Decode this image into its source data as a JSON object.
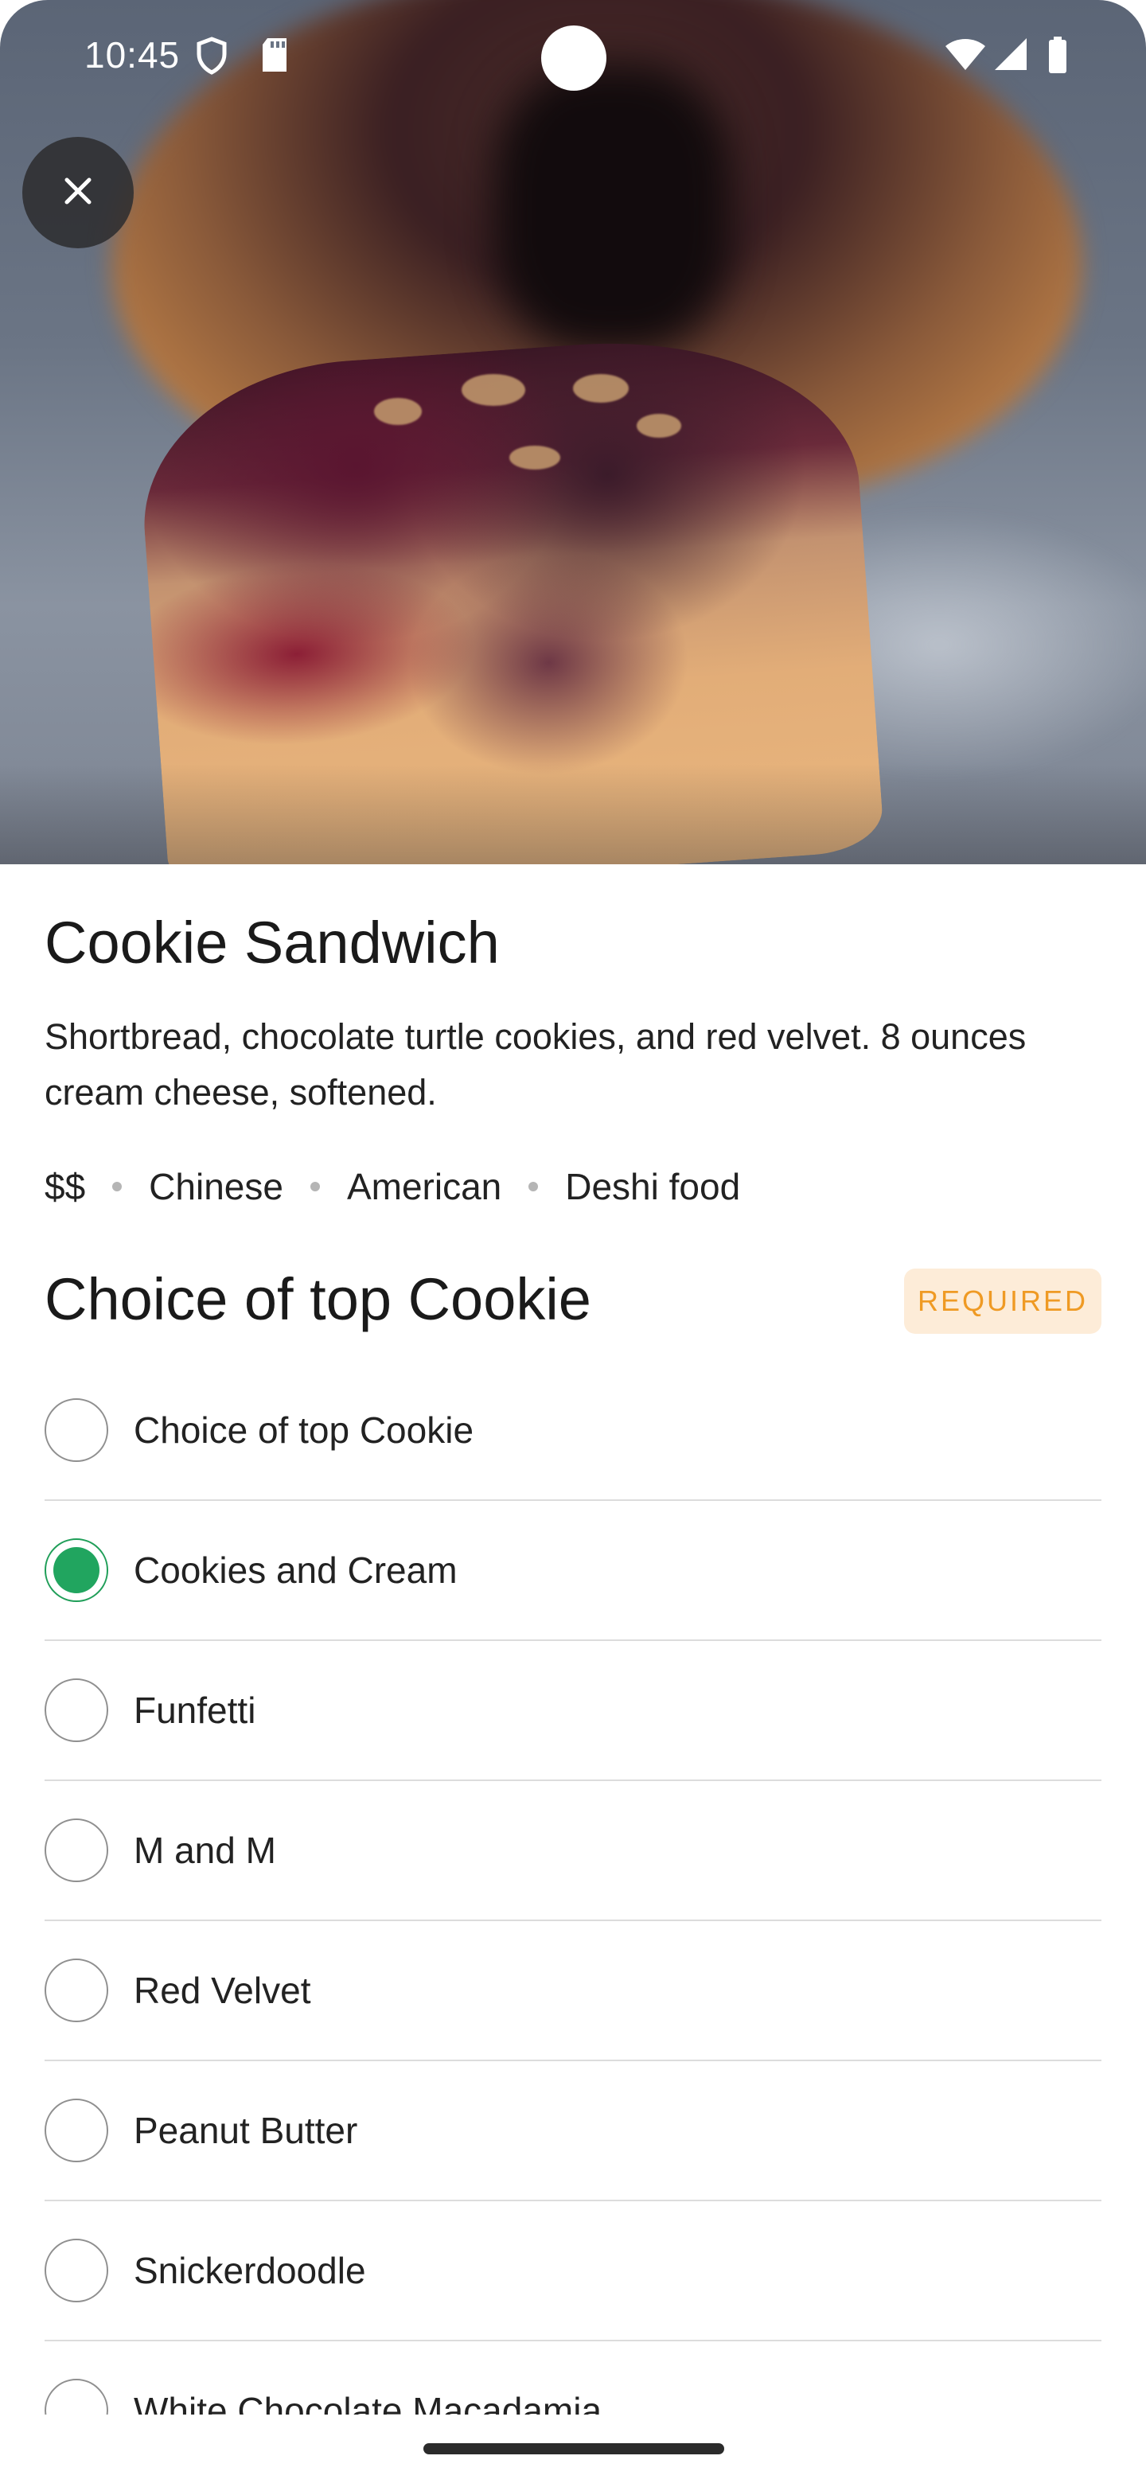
{
  "status_bar": {
    "time": "10:45"
  },
  "header": {
    "close_icon": "close-icon"
  },
  "item": {
    "title": "Cookie Sandwich",
    "description": "Shortbread, chocolate turtle cookies, and red velvet. 8 ounces cream cheese, softened.",
    "tags": [
      "$$",
      "Chinese",
      "American",
      "Deshi food"
    ]
  },
  "choice_section": {
    "title": "Choice of top Cookie",
    "required_label": "REQUIRED",
    "options": [
      {
        "label": "Choice of top Cookie",
        "selected": false
      },
      {
        "label": "Cookies and Cream",
        "selected": true
      },
      {
        "label": "Funfetti",
        "selected": false
      },
      {
        "label": "M and M",
        "selected": false
      },
      {
        "label": "Red Velvet",
        "selected": false
      },
      {
        "label": "Peanut Butter",
        "selected": false
      },
      {
        "label": "Snickerdoodle",
        "selected": false
      },
      {
        "label": "White Chocolate Macadamia",
        "selected": false
      }
    ]
  },
  "colors": {
    "accent_green": "#21a55f",
    "required_text": "#ef9a24",
    "required_bg": "#fdecd8"
  }
}
